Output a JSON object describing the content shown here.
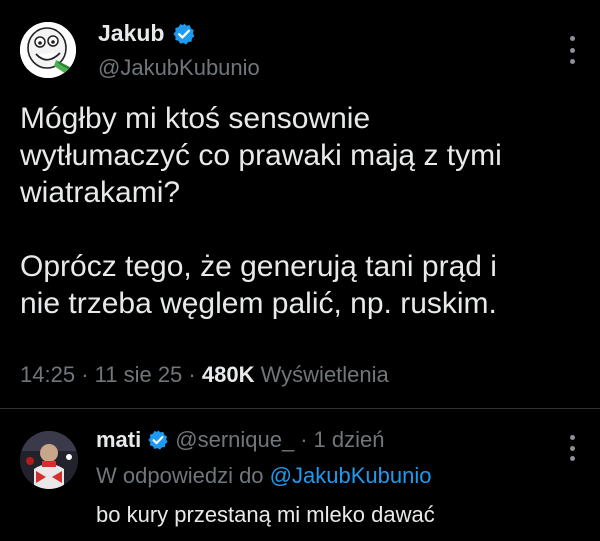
{
  "tweet": {
    "author_name": "Jakub",
    "handle": "@JakubKubunio",
    "avatar_icon": "smiley-face-avatar-icon",
    "verified_icon": "verified-badge-icon",
    "verified_color": "#1d9bf0",
    "paragraph1_line1": "Mógłby mi ktoś sensownie",
    "paragraph1_line2": "wytłumaczyć co prawaki mają z tymi",
    "paragraph1_line3": "wiatrakami?",
    "paragraph2_line1": "Oprócz tego, że generują tani prąd i",
    "paragraph2_line2": "nie trzeba węglem palić, np. ruskim.",
    "time": "14:25",
    "date": "11 sie 25",
    "views_count": "480K",
    "views_label": "Wyświetlenia",
    "separator": "·"
  },
  "reply": {
    "author_name": "mati",
    "handle": "@sernique_",
    "separator": "·",
    "age": "1 dzień",
    "replying_prefix": "W odpowiedzi do",
    "replying_to": "@JakubKubunio",
    "text": "bo kury przestaną mi mleko dawać",
    "verified_icon": "verified-badge-icon"
  },
  "colors": {
    "background": "#000000",
    "text_primary": "#e7e9ea",
    "text_secondary": "#71767b",
    "accent": "#1d9bf0",
    "divider": "#2f3336"
  }
}
